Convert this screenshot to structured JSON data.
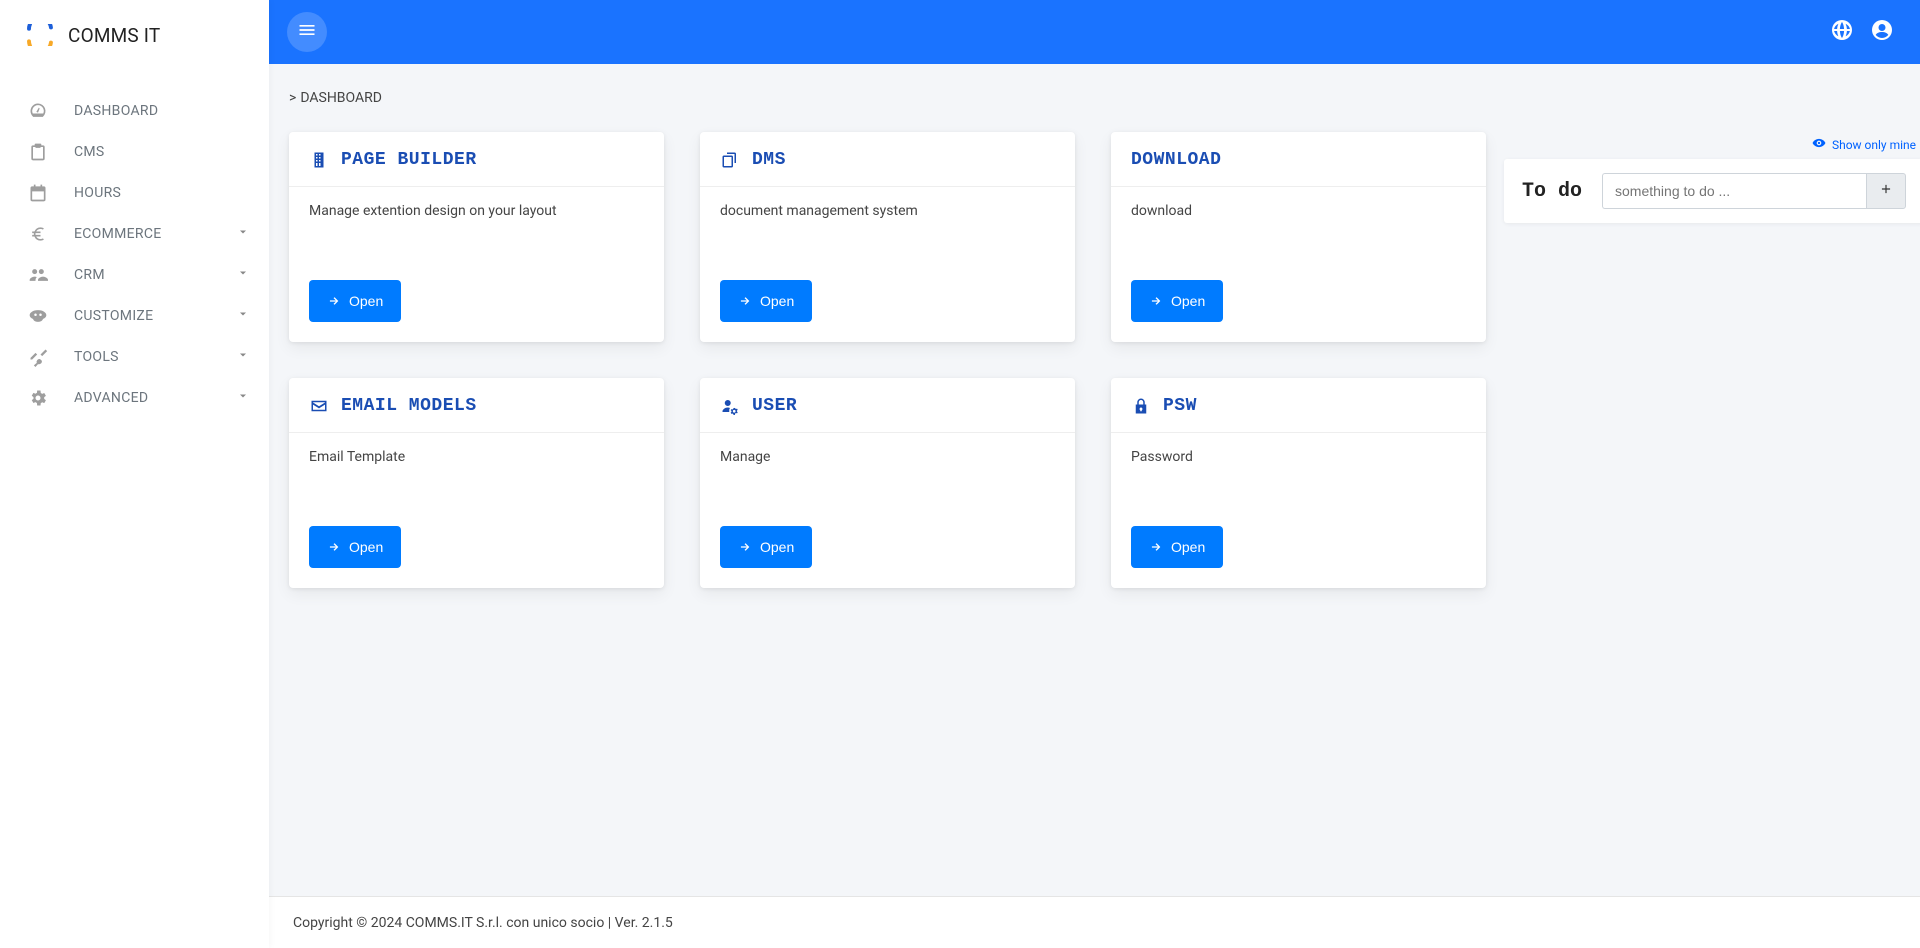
{
  "brand": {
    "name": "COMMS IT"
  },
  "breadcrumb": {
    "prefix": ">",
    "current": "DASHBOARD"
  },
  "sidebar": {
    "items": [
      {
        "label": "DASHBOARD",
        "expandable": false,
        "icon": "gauge"
      },
      {
        "label": "CMS",
        "expandable": false,
        "icon": "clipboard"
      },
      {
        "label": "HOURS",
        "expandable": false,
        "icon": "calendar"
      },
      {
        "label": "ECOMMERCE",
        "expandable": true,
        "icon": "euro"
      },
      {
        "label": "CRM",
        "expandable": true,
        "icon": "people"
      },
      {
        "label": "CUSTOMIZE",
        "expandable": true,
        "icon": "mask"
      },
      {
        "label": "TOOLS",
        "expandable": true,
        "icon": "tools"
      },
      {
        "label": "ADVANCED",
        "expandable": true,
        "icon": "gear"
      }
    ]
  },
  "cards": [
    {
      "title": "PAGE BUILDER",
      "desc": "Manage extention design on your layout",
      "btn": "Open",
      "icon": "building"
    },
    {
      "title": "DMS",
      "desc": "document management system",
      "btn": "Open",
      "icon": "copy"
    },
    {
      "title": "DOWNLOAD",
      "desc": "download",
      "btn": "Open",
      "icon": ""
    },
    {
      "title": "EMAIL MODELS",
      "desc": "Email Template",
      "btn": "Open",
      "icon": "envelope"
    },
    {
      "title": "USER",
      "desc": "Manage",
      "btn": "Open",
      "icon": "user-gear"
    },
    {
      "title": "PSW",
      "desc": "Password",
      "btn": "Open",
      "icon": "lock"
    }
  ],
  "todo": {
    "heading": "To do",
    "placeholder": "something to do ...",
    "show_only_mine": "Show only mine"
  },
  "footer": {
    "text": "Copyright © 2024 COMMS.IT S.r.l. con unico socio | Ver. 2.1.5"
  }
}
